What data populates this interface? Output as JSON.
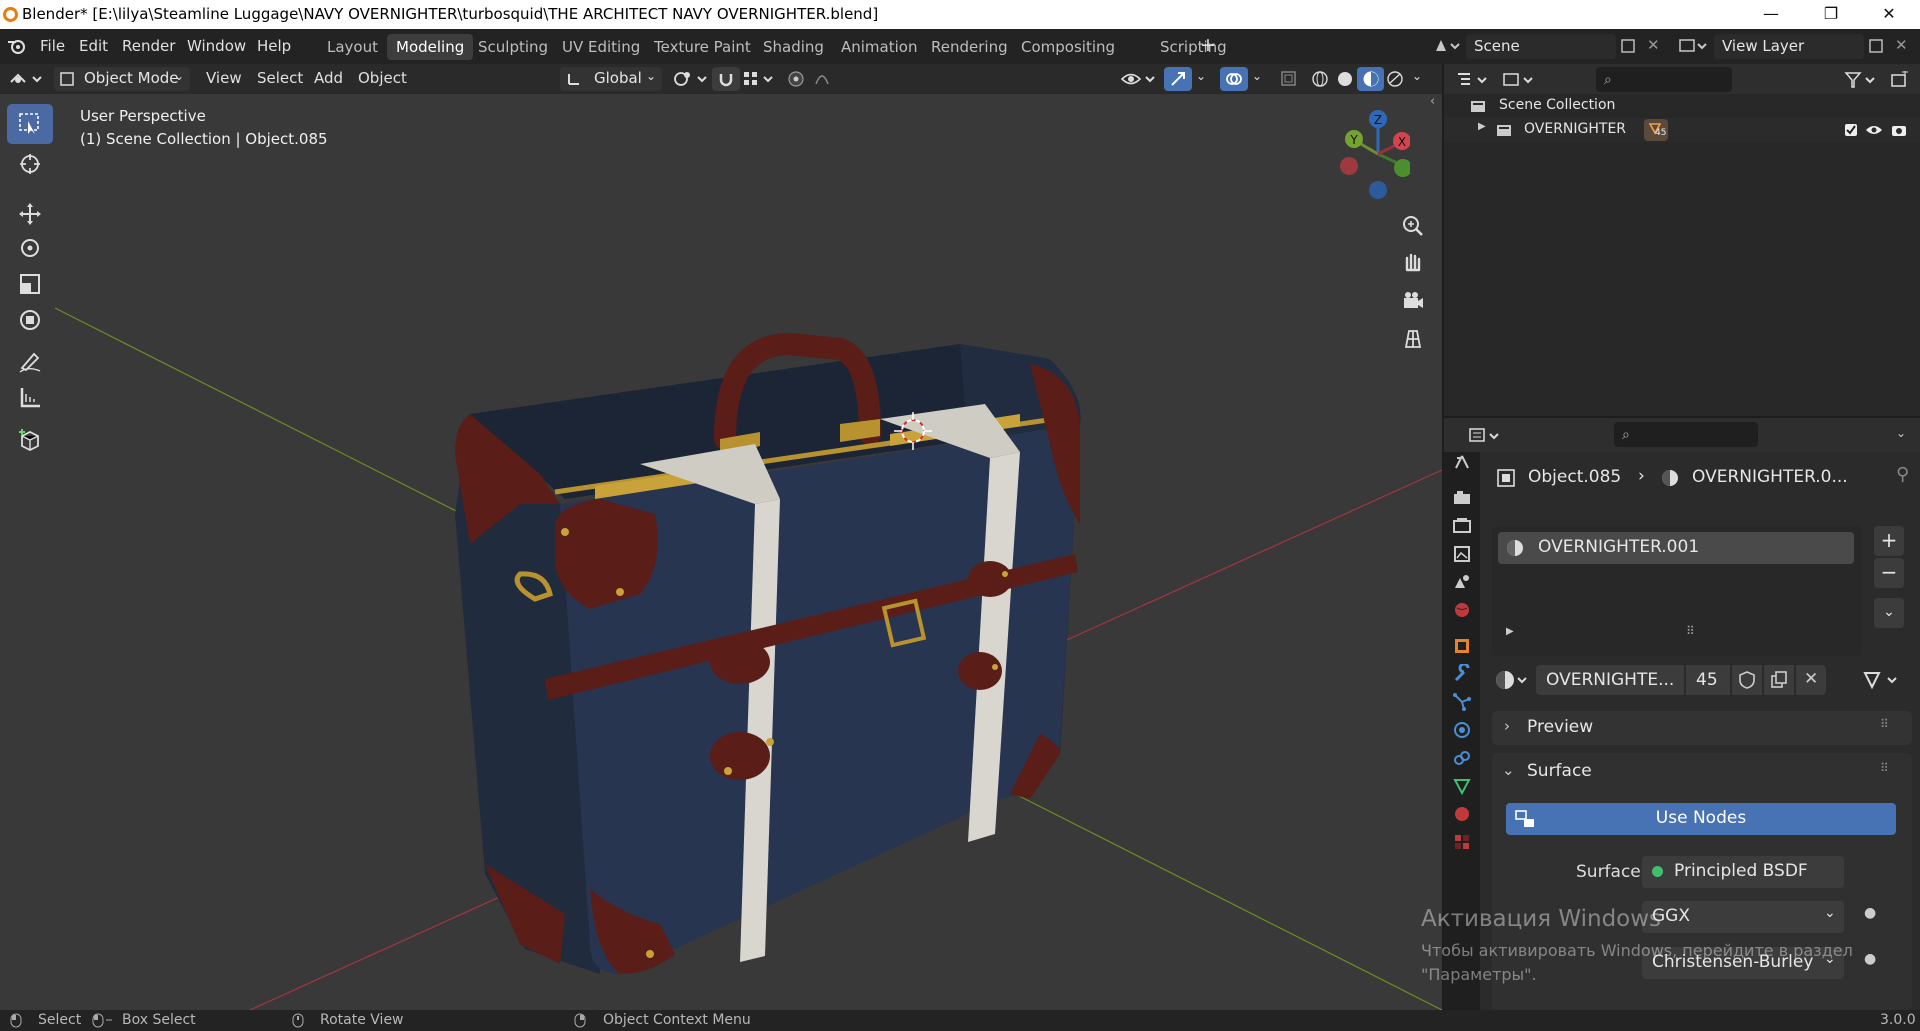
{
  "window": {
    "title": "Blender* [E:\\lilya\\Steamline Luggage\\NAVY OVERNIGHTER\\turbosquid\\THE ARCHITECT NAVY OVERNIGHTER.blend]",
    "minimize": "—",
    "maximize": "❐",
    "close": "✕"
  },
  "menu": {
    "items": [
      "File",
      "Edit",
      "Render",
      "Window",
      "Help"
    ]
  },
  "workspaces": {
    "tabs": [
      "Layout",
      "Modeling",
      "Sculpting",
      "UV Editing",
      "Texture Paint",
      "Shading",
      "Animation",
      "Rendering",
      "Compositing",
      "Scripting"
    ],
    "active": "Modeling",
    "add": "+"
  },
  "scene": {
    "name": "Scene",
    "view_layer": "View Layer"
  },
  "viewport_header": {
    "mode": "Object Mode",
    "menus": [
      "View",
      "Select",
      "Add",
      "Object"
    ],
    "orientation": "Global"
  },
  "viewport": {
    "perspective": "User Perspective",
    "collection_info": "(1) Scene Collection | Object.085",
    "gizmo": {
      "z": "Z",
      "y": "Y",
      "x": "X"
    }
  },
  "outliner": {
    "root": "Scene Collection",
    "child": "OVERNIGHTER",
    "child_count": "45"
  },
  "properties": {
    "breadcrumb_object": "Object.085",
    "breadcrumb_material": "OVERNIGHTER.0...",
    "material_slot": "OVERNIGHTER.001",
    "material_name": "OVERNIGHTE...",
    "material_users": "45",
    "panels": {
      "preview": "Preview",
      "surface": "Surface"
    },
    "use_nodes": "Use Nodes",
    "surface_label": "Surface",
    "surface_value": "Principled BSDF",
    "distribution": "GGX",
    "subsurface": "Christensen-Burley"
  },
  "watermark": {
    "line1": "Активация Windows",
    "line2": "Чтобы активировать Windows, перейдите в раздел",
    "line3": "\"Параметры\"."
  },
  "statusbar": {
    "select": "Select",
    "box_select": "Box Select",
    "rotate": "Rotate View",
    "context_menu": "Object Context Menu",
    "version": "3.0.0"
  },
  "colors": {
    "accent": "#4772b3",
    "suitcase_body": "#26324a",
    "leather": "#5a1d18",
    "brass": "#b8922e",
    "strap_white": "#d8d6cf"
  }
}
